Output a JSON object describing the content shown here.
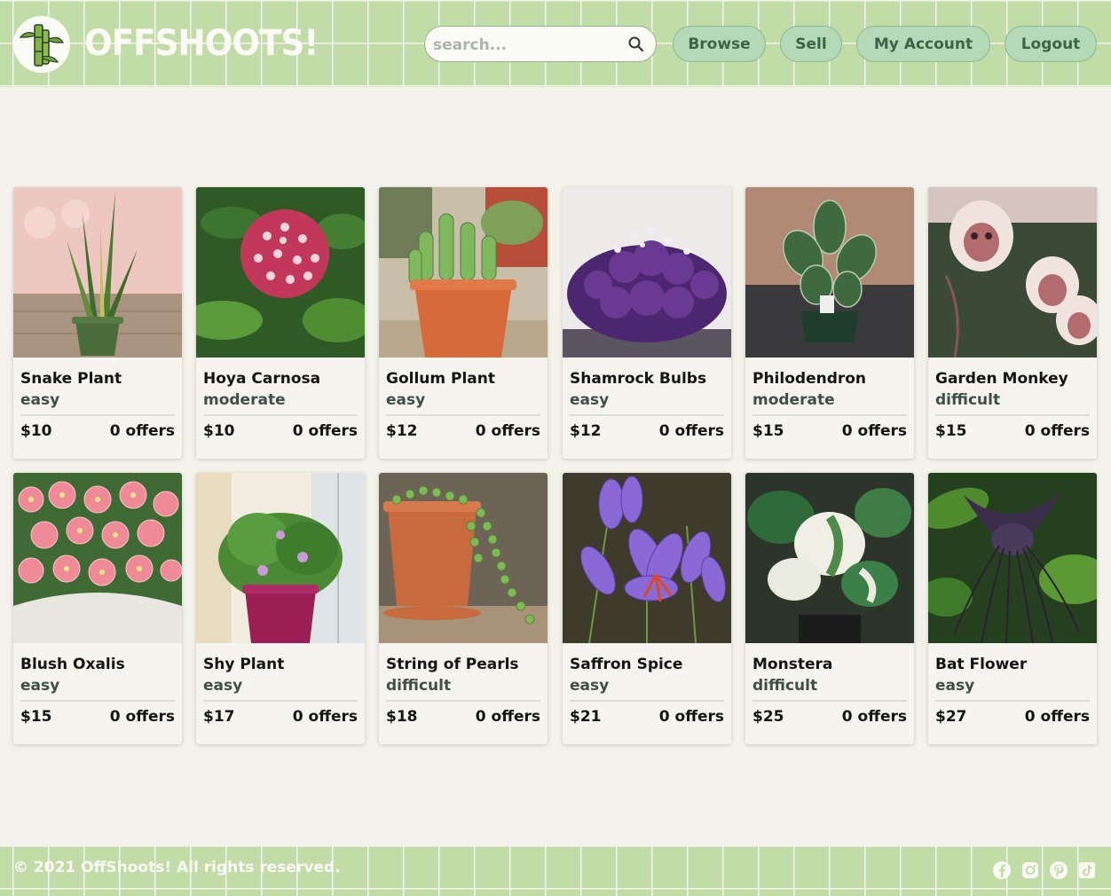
{
  "header": {
    "brand": "OFFSHOOTS!",
    "search_placeholder": "search...",
    "search_icon": "magnifier",
    "nav": [
      {
        "label": "Browse"
      },
      {
        "label": "Sell"
      },
      {
        "label": "My Account"
      },
      {
        "label": "Logout"
      }
    ]
  },
  "products": [
    {
      "name": "Snake Plant",
      "difficulty": "easy",
      "price": "$10",
      "offers": "0 offers"
    },
    {
      "name": "Hoya Carnosa",
      "difficulty": "moderate",
      "price": "$10",
      "offers": "0 offers"
    },
    {
      "name": "Gollum Plant",
      "difficulty": "easy",
      "price": "$12",
      "offers": "0 offers"
    },
    {
      "name": "Shamrock Bulbs",
      "difficulty": "easy",
      "price": "$12",
      "offers": "0 offers"
    },
    {
      "name": "Philodendron",
      "difficulty": "moderate",
      "price": "$15",
      "offers": "0 offers"
    },
    {
      "name": "Garden Monkey",
      "difficulty": "difficult",
      "price": "$15",
      "offers": "0 offers"
    },
    {
      "name": "Blush Oxalis",
      "difficulty": "easy",
      "price": "$15",
      "offers": "0 offers"
    },
    {
      "name": "Shy Plant",
      "difficulty": "easy",
      "price": "$17",
      "offers": "0 offers"
    },
    {
      "name": "String of Pearls",
      "difficulty": "difficult",
      "price": "$18",
      "offers": "0 offers"
    },
    {
      "name": "Saffron Spice",
      "difficulty": "easy",
      "price": "$21",
      "offers": "0 offers"
    },
    {
      "name": "Monstera",
      "difficulty": "difficult",
      "price": "$25",
      "offers": "0 offers"
    },
    {
      "name": "Bat Flower",
      "difficulty": "easy",
      "price": "$27",
      "offers": "0 offers"
    }
  ],
  "footer": {
    "copyright": "© 2021 OffShoots! All rights reserved.",
    "social_icons": [
      "facebook-icon",
      "instagram-icon",
      "pinterest-icon",
      "tiktok-icon"
    ]
  },
  "colors": {
    "header_green": "#c2dca8",
    "button_green": "#b5d8b7",
    "button_text": "#3f6149",
    "page_bg": "#f3f2eb"
  }
}
